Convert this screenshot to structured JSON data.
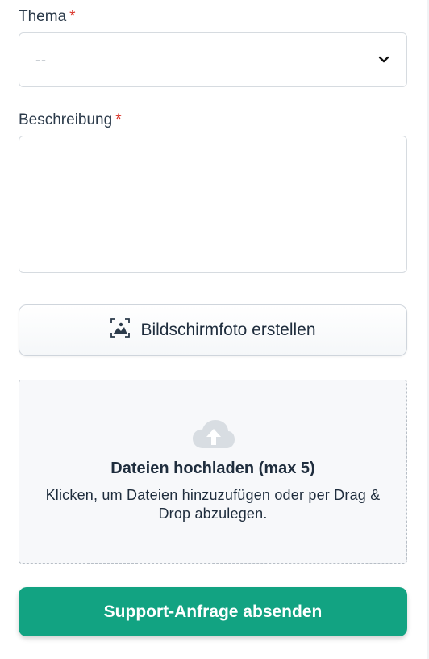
{
  "form": {
    "topic": {
      "label": "Thema",
      "required_mark": "*",
      "selected_value": "--"
    },
    "description": {
      "label": "Beschreibung",
      "required_mark": "*",
      "value": ""
    },
    "screenshot_button": {
      "label": "Bildschirmfoto erstellen",
      "icon": "image-capture-icon"
    },
    "upload": {
      "icon": "cloud-upload-icon",
      "title": "Dateien hochladen (max 5)",
      "hint": "Klicken, um Dateien hinzuzufügen oder per Drag & Drop abzulegen."
    },
    "submit_button": {
      "label": "Support-Anfrage absenden"
    }
  },
  "colors": {
    "accent": "#12a382",
    "required": "#d93025",
    "text": "#1f2d3d",
    "border": "#d6dbe0"
  }
}
